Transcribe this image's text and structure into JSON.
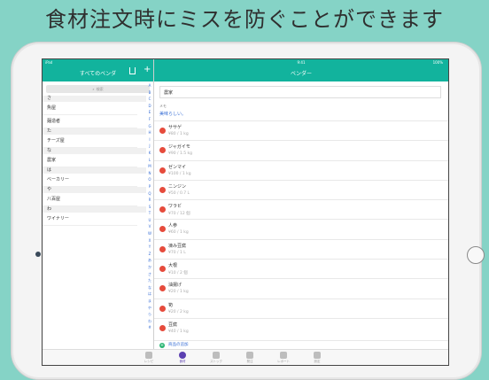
{
  "headline": "食材注文時にミスを防ぐことができます",
  "status": {
    "carrier": "iPad",
    "time": "9:41",
    "battery": "100%"
  },
  "left": {
    "title": "すべてのベンダ",
    "search_placeholder": "検索",
    "sections": [
      {
        "header": "さ",
        "rows": [
          "魚屋"
        ]
      },
      {
        "header": "",
        "rows": [
          "麺造者"
        ]
      },
      {
        "header": "た",
        "rows": [
          "チーズ屋"
        ]
      },
      {
        "header": "な",
        "rows": [
          "農家"
        ]
      },
      {
        "header": "は",
        "rows": [
          "ベーカリー"
        ]
      },
      {
        "header": "や",
        "rows": [
          "八百屋"
        ]
      },
      {
        "header": "わ",
        "rows": [
          "ワイナリー"
        ]
      }
    ],
    "index": [
      "A",
      "B",
      "C",
      "D",
      "E",
      "F",
      "G",
      "H",
      "I",
      "J",
      "K",
      "L",
      "M",
      "N",
      "O",
      "P",
      "Q",
      "R",
      "S",
      "T",
      "U",
      "V",
      "W",
      "X",
      "Y",
      "Z",
      "あ",
      "か",
      "さ",
      "た",
      "な",
      "は",
      "ま",
      "や",
      "ら",
      "わ",
      "#"
    ]
  },
  "right": {
    "title": "ベンダー",
    "vendor_name": "農家",
    "memo_label": "メモ",
    "memo_value": "美味らしい。",
    "items": [
      {
        "name": "ササゲ",
        "price": "¥80 / 1 kg"
      },
      {
        "name": "ジャガイモ",
        "price": "¥90 / 1.5 kg"
      },
      {
        "name": "ゼンマイ",
        "price": "¥100 / 1 kg"
      },
      {
        "name": "ニンジン",
        "price": "¥50 / 0.7 L"
      },
      {
        "name": "ワラビ",
        "price": "¥70 / 12 個"
      },
      {
        "name": "人参",
        "price": "¥60 / 1 kg"
      },
      {
        "name": "凍み豆腐",
        "price": "¥70 / 1 L"
      },
      {
        "name": "大根",
        "price": "¥10 / 2 個"
      },
      {
        "name": "油揚げ",
        "price": "¥20 / 1 kg"
      },
      {
        "name": "筍",
        "price": "¥20 / 2 kg"
      },
      {
        "name": "豆腐",
        "price": "¥40 / 1 kg"
      }
    ],
    "add_item": "商品の追加"
  },
  "tabs": [
    {
      "label": "レシピ",
      "active": false
    },
    {
      "label": "食材",
      "active": true
    },
    {
      "label": "ストック",
      "active": false
    },
    {
      "label": "発注",
      "active": false
    },
    {
      "label": "レポート",
      "active": false
    },
    {
      "label": "設定",
      "active": false
    }
  ]
}
